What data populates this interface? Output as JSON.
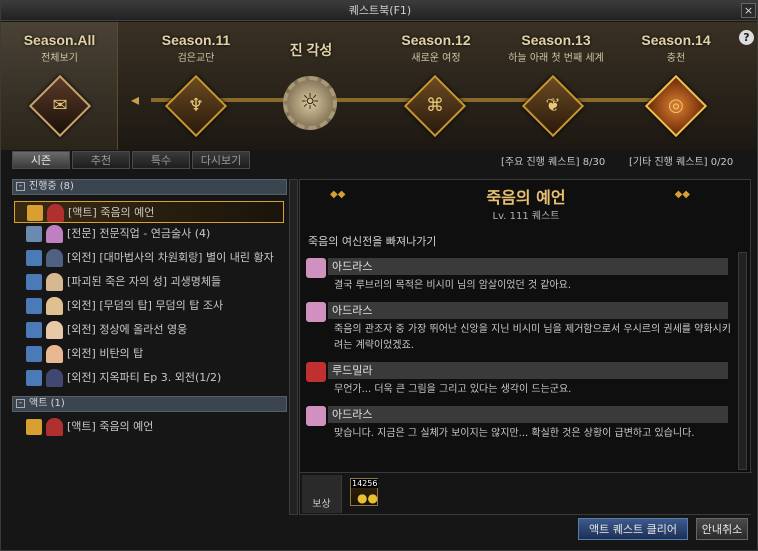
{
  "window": {
    "title": "퀘스트북(F1)",
    "close": "×"
  },
  "seasons": [
    {
      "title": "Season.All",
      "subtitle": "전체보기",
      "icon": "scroll-icon"
    },
    {
      "title": "Season.11",
      "subtitle": "검은교단",
      "icon": "trident-icon"
    },
    {
      "title": "진 각성",
      "subtitle": "",
      "icon": "gear-emblem-icon"
    },
    {
      "title": "Season.12",
      "subtitle": "새로운 여정",
      "icon": "knot-icon"
    },
    {
      "title": "Season.13",
      "subtitle": "하늘 아래 첫 번째 세계",
      "icon": "branch-icon"
    },
    {
      "title": "Season.14",
      "subtitle": "충천",
      "icon": "seal-icon"
    }
  ],
  "help": "?",
  "tabs": [
    "시즌",
    "추천",
    "특수",
    "다시보기"
  ],
  "counters": {
    "main": "[주요 진행 퀘스트] 8/30",
    "other": "[기타 진행 퀘스트] 0/20"
  },
  "groups": [
    {
      "label": "진행중 (8)",
      "toggle": "-"
    },
    {
      "label": "액트 (1)",
      "toggle": "-"
    }
  ],
  "quests": [
    {
      "text": "[액트] 죽음의 예언"
    },
    {
      "text": "[전문] 전문직업 - 연금술사 (4)"
    },
    {
      "text": "[외전] [대마법사의 차원회랑] 별이 내린 황자"
    },
    {
      "text": "[파괴된 죽은 자의 성] 괴생명체들"
    },
    {
      "text": "[외전] [무덤의 탑] 무덤의 탑 조사"
    },
    {
      "text": "[외전] 정상에 올라선 영웅"
    },
    {
      "text": "[외전] 비탄의 탑"
    },
    {
      "text": "[외전] 지옥파티 Ep 3. 외전(1/2)"
    }
  ],
  "act_quests": [
    {
      "text": "[액트] 죽음의 예언"
    }
  ],
  "detail": {
    "title": "죽음의 예언",
    "level": "Lv. 111 퀘스트",
    "description": "죽음의 여신전을 빠져나가기",
    "dialogs": [
      {
        "speaker": "아드라스",
        "text": "결국 루브리의 목적은 비시미 님의 암살이었던 것 같아요."
      },
      {
        "speaker": "아드라스",
        "text": "죽음의 관조자 중 가장 뛰어난 신앙을 지닌 비시미 님을 제거함으로서 우시르의 권세를 약화시키려는 계략이었겠죠."
      },
      {
        "speaker": "루드밀라",
        "text": "무언가... 더욱 큰 그림을 그리고 있다는 생각이 드는군요."
      },
      {
        "speaker": "아드라스",
        "text": "맞습니다. 지금은 그 실체가 보이지는 않지만... 확실한 것은 상황이 급변하고 있습니다."
      }
    ],
    "reward_label": "보상",
    "reward_count": "14256"
  },
  "buttons": {
    "complete": "액트 퀘스트 클리어",
    "cancel": "안내취소"
  },
  "colors": {
    "accent": "#d8a030",
    "title": "#e8c070",
    "button": "#3c5a8a"
  }
}
